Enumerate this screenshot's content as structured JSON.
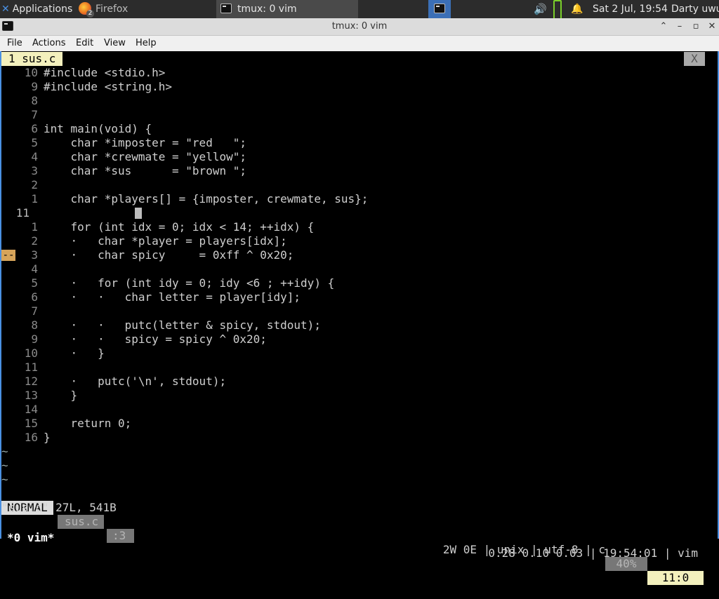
{
  "panel": {
    "applications": "Applications",
    "firefox": "Firefox",
    "firefox_badge": "2",
    "task_title": "tmux: 0 vim",
    "clock": "Sat  2 Jul, 19:54",
    "user": "Darty uwu"
  },
  "window": {
    "title": "tmux: 0 vim",
    "menu": [
      "File",
      "Actions",
      "Edit",
      "View",
      "Help"
    ]
  },
  "vim": {
    "tab_label": "1 sus.c",
    "tab_close": "X",
    "lines": [
      {
        "num": "10",
        "code": "#include <stdio.h>"
      },
      {
        "num": "9",
        "code": "#include <string.h>"
      },
      {
        "num": "8",
        "code": ""
      },
      {
        "num": "7",
        "code": ""
      },
      {
        "num": "6",
        "code": "int main(void) {"
      },
      {
        "num": "5",
        "code": "    char *imposter = \"red   \";"
      },
      {
        "num": "4",
        "code": "    char *crewmate = \"yellow\";"
      },
      {
        "num": "3",
        "code": "    char *sus      = \"brown \";"
      },
      {
        "num": "2",
        "code": ""
      },
      {
        "num": "1",
        "code": "    char *players[] = {imposter, crewmate, sus};"
      },
      {
        "num": "11",
        "code": ""
      },
      {
        "num": "1",
        "code": "    for (int idx = 0; idx < 14; ++idx) {"
      },
      {
        "num": "2",
        "code": "    ·   char *player = players[idx];"
      },
      {
        "num": "3",
        "code": "    ·   char spicy     = 0xff ^ 0x20;"
      },
      {
        "num": "4",
        "code": ""
      },
      {
        "num": "5",
        "code": "    ·   for (int idy = 0; idy <6 ; ++idy) {"
      },
      {
        "num": "6",
        "code": "    ·   ·   char letter = player[idy];"
      },
      {
        "num": "7",
        "code": ""
      },
      {
        "num": "8",
        "code": "    ·   ·   putc(letter & spicy, stdout);"
      },
      {
        "num": "9",
        "code": "    ·   ·   spicy = spicy ^ 0x20;"
      },
      {
        "num": "10",
        "code": "    ·   }"
      },
      {
        "num": "11",
        "code": ""
      },
      {
        "num": "12",
        "code": "    ·   putc('\\n', stdout);"
      },
      {
        "num": "13",
        "code": "    }"
      },
      {
        "num": "14",
        "code": ""
      },
      {
        "num": "15",
        "code": "    return 0;"
      },
      {
        "num": "16",
        "code": "}"
      }
    ],
    "sign_text": "--",
    "tilde": "~",
    "status": {
      "mode": "NORMAL",
      "file": "sus.c",
      "pos": ":3",
      "info": "2W 0E | unix | utf-8 | c",
      "percent": "40%",
      "linecol": "11:0"
    },
    "cmdline": "\"sus.c\" 27L, 541B"
  },
  "tmux": {
    "window": "*0 vim*",
    "right": "0.28 0.10 0.03 | 19:54:01 | vim"
  }
}
